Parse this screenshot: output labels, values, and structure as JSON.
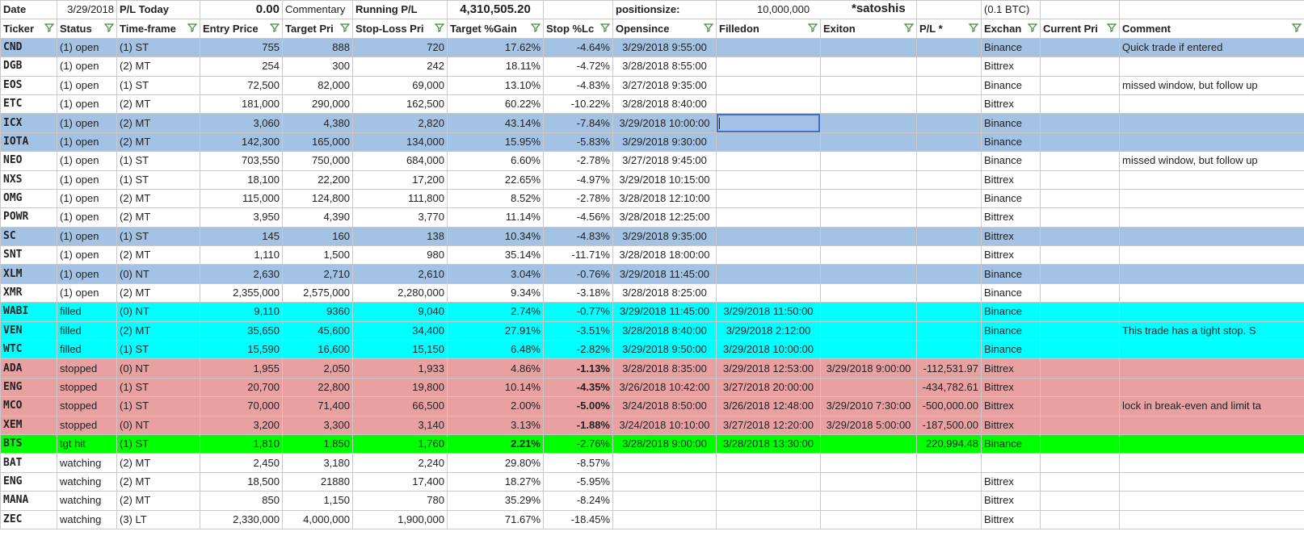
{
  "colors": {
    "open_blue": "#a4c2e4",
    "filled_cyan": "#00ffff",
    "stopped_red": "#e8a0a0",
    "tgt_green": "#00ff00",
    "filter_icon": "#3a8a3a",
    "white": "#ffffff"
  },
  "meta": {
    "date_label": "Date",
    "date_value": "3/29/2018",
    "pl_today_label": "P/L Today",
    "pl_today_value": "0.00",
    "commentary_label": "Commentary",
    "running_pl_label": "Running P/L",
    "running_pl_value": "4,310,505.20",
    "positionsize_label": "positionsize:",
    "positionsize_value": "10,000,000",
    "satoshis_label": "*satoshis",
    "btc_note": "(0.1 BTC)"
  },
  "headers": [
    "Ticker",
    "Status",
    "Time-frame",
    "Entry Price",
    "Target Pri",
    "Stop-Loss Pri",
    "Target %Gain",
    "Stop %Lc",
    "Opensince",
    "Filledon",
    "Exiton",
    "P/L *",
    "Exchan",
    "Current Pri",
    "Comment"
  ],
  "rows": [
    {
      "c": [
        "CND",
        "(1) open",
        "(1) ST",
        "755",
        "888",
        "720",
        "17.62%",
        "-4.64%",
        "3/29/2018 9:55:00",
        "",
        "",
        "",
        "Binance",
        "",
        "Quick trade if entered"
      ],
      "color": "open_blue"
    },
    {
      "c": [
        "DGB",
        "(1) open",
        "(2) MT",
        "254",
        "300",
        "242",
        "18.11%",
        "-4.72%",
        "3/28/2018 8:55:00",
        "",
        "",
        "",
        "Bittrex",
        "",
        ""
      ],
      "color": "white"
    },
    {
      "c": [
        "EOS",
        "(1) open",
        "(1) ST",
        "72,500",
        "82,000",
        "69,000",
        "13.10%",
        "-4.83%",
        "3/27/2018 9:35:00",
        "",
        "",
        "",
        "Binance",
        "",
        "missed window, but follow up"
      ],
      "color": "white"
    },
    {
      "c": [
        "ETC",
        "(1) open",
        "(2) MT",
        "181,000",
        "290,000",
        "162,500",
        "60.22%",
        "-10.22%",
        "3/28/2018 8:40:00",
        "",
        "",
        "",
        "Bittrex",
        "",
        ""
      ],
      "color": "white"
    },
    {
      "c": [
        "ICX",
        "(1) open",
        "(2) MT",
        "3,060",
        "4,380",
        "2,820",
        "43.14%",
        "-7.84%",
        "3/29/2018 10:00:00",
        "",
        "",
        "",
        "Binance",
        "",
        ""
      ],
      "color": "open_blue"
    },
    {
      "c": [
        "IOTA",
        "(1) open",
        "(2) MT",
        "142,300",
        "165,000",
        "134,000",
        "15.95%",
        "-5.83%",
        "3/29/2018 9:30:00",
        "",
        "",
        "",
        "Binance",
        "",
        ""
      ],
      "color": "open_blue"
    },
    {
      "c": [
        "NEO",
        "(1) open",
        "(1) ST",
        "703,550",
        "750,000",
        "684,000",
        "6.60%",
        "-2.78%",
        "3/27/2018 9:45:00",
        "",
        "",
        "",
        "Binance",
        "",
        "missed window, but follow up"
      ],
      "color": "white"
    },
    {
      "c": [
        "NXS",
        "(1) open",
        "(1) ST",
        "18,100",
        "22,200",
        "17,200",
        "22.65%",
        "-4.97%",
        "3/29/2018 10:15:00",
        "",
        "",
        "",
        "Bittrex",
        "",
        ""
      ],
      "color": "white"
    },
    {
      "c": [
        "OMG",
        "(1) open",
        "(2) MT",
        "115,000",
        "124,800",
        "111,800",
        "8.52%",
        "-2.78%",
        "3/28/2018 12:10:00",
        "",
        "",
        "",
        "Binance",
        "",
        ""
      ],
      "color": "white"
    },
    {
      "c": [
        "POWR",
        "(1) open",
        "(2) MT",
        "3,950",
        "4,390",
        "3,770",
        "11.14%",
        "-4.56%",
        "3/28/2018 12:25:00",
        "",
        "",
        "",
        "Bittrex",
        "",
        ""
      ],
      "color": "white"
    },
    {
      "c": [
        "SC",
        "(1) open",
        "(1) ST",
        "145",
        "160",
        "138",
        "10.34%",
        "-4.83%",
        "3/29/2018 9:35:00",
        "",
        "",
        "",
        "Bittrex",
        "",
        ""
      ],
      "color": "open_blue"
    },
    {
      "c": [
        "SNT",
        "(1) open",
        "(2) MT",
        "1,110",
        "1,500",
        "980",
        "35.14%",
        "-11.71%",
        "3/28/2018 18:00:00",
        "",
        "",
        "",
        "Bittrex",
        "",
        ""
      ],
      "color": "white"
    },
    {
      "c": [
        "XLM",
        "(1) open",
        "(0) NT",
        "2,630",
        "2,710",
        "2,610",
        "3.04%",
        "-0.76%",
        "3/29/2018 11:45:00",
        "",
        "",
        "",
        "Binance",
        "",
        ""
      ],
      "color": "open_blue"
    },
    {
      "c": [
        "XMR",
        "(1) open",
        "(2) MT",
        "2,355,000",
        "2,575,000",
        "2,280,000",
        "9.34%",
        "-3.18%",
        "3/28/2018 8:25:00",
        "",
        "",
        "",
        "Binance",
        "",
        ""
      ],
      "color": "white"
    },
    {
      "c": [
        "WABI",
        "filled",
        "(0) NT",
        "9,110",
        "9360",
        "9,040",
        "2.74%",
        "-0.77%",
        "3/29/2018 11:45:00",
        "3/29/2018 11:50:00",
        "",
        "",
        "Binance",
        "",
        ""
      ],
      "color": "filled_cyan"
    },
    {
      "c": [
        "VEN",
        "filled",
        "(2) MT",
        "35,650",
        "45,600",
        "34,400",
        "27.91%",
        "-3.51%",
        "3/28/2018 8:40:00",
        "3/29/2018 2:12:00",
        "",
        "",
        "Binance",
        "",
        "This trade has a tight stop. S"
      ],
      "color": "filled_cyan"
    },
    {
      "c": [
        "WTC",
        "filled",
        "(1) ST",
        "15,590",
        "16,600",
        "15,150",
        "6.48%",
        "-2.82%",
        "3/29/2018 9:50:00",
        "3/29/2018 10:00:00",
        "",
        "",
        "Binance",
        "",
        ""
      ],
      "color": "filled_cyan"
    },
    {
      "c": [
        "ADA",
        "stopped",
        "(0) NT",
        "1,955",
        "2,050",
        "1,933",
        "4.86%",
        "-1.13%",
        "3/28/2018 8:35:00",
        "3/29/2018 12:53:00",
        "3/29/2018 9:00:00",
        "-112,531.97",
        "Bittrex",
        "",
        ""
      ],
      "color": "stopped_red",
      "boldStop": true
    },
    {
      "c": [
        "ENG",
        "stopped",
        "(1) ST",
        "20,700",
        "22,800",
        "19,800",
        "10.14%",
        "-4.35%",
        "3/26/2018 10:42:00",
        "3/27/2018 20:00:00",
        "",
        "-434,782.61",
        "Bittrex",
        "",
        ""
      ],
      "color": "stopped_red",
      "boldStop": true
    },
    {
      "c": [
        "MCO",
        "stopped",
        "(1) ST",
        "70,000",
        "71,400",
        "66,500",
        "2.00%",
        "-5.00%",
        "3/24/2018 8:50:00",
        "3/26/2018 12:48:00",
        "3/29/2010 7:30:00",
        "-500,000.00",
        "Bittrex",
        "",
        "lock in break-even and limit ta"
      ],
      "color": "stopped_red",
      "boldStop": true
    },
    {
      "c": [
        "XEM",
        "stopped",
        "(0) NT",
        "3,200",
        "3,300",
        "3,140",
        "3.13%",
        "-1.88%",
        "3/24/2018 10:10:00",
        "3/27/2018 12:20:00",
        "3/29/2018 5:00:00",
        "-187,500.00",
        "Bittrex",
        "",
        ""
      ],
      "color": "stopped_red",
      "boldStop": true
    },
    {
      "c": [
        "BTS",
        "tgt hit",
        "(1) ST",
        "1,810",
        "1,850",
        "1,760",
        "2.21%",
        "-2.76%",
        "3/28/2018 9:00:00",
        "3/28/2018 13:30:00",
        "",
        "220,994.48",
        "Binance",
        "",
        ""
      ],
      "color": "tgt_green",
      "boldGain": true
    },
    {
      "c": [
        "BAT",
        "watching",
        "(2) MT",
        "2,450",
        "3,180",
        "2,240",
        "29.80%",
        "-8.57%",
        "",
        "",
        "",
        "",
        "",
        "",
        ""
      ],
      "color": "white"
    },
    {
      "c": [
        "ENG",
        "watching",
        "(2) MT",
        "18,500",
        "21880",
        "17,400",
        "18.27%",
        "-5.95%",
        "",
        "",
        "",
        "",
        "Bittrex",
        "",
        ""
      ],
      "color": "white"
    },
    {
      "c": [
        "MANA",
        "watching",
        "(2) MT",
        "850",
        "1,150",
        "780",
        "35.29%",
        "-8.24%",
        "",
        "",
        "",
        "",
        "Bittrex",
        "",
        ""
      ],
      "color": "white"
    },
    {
      "c": [
        "ZEC",
        "watching",
        "(3) LT",
        "2,330,000",
        "4,000,000",
        "1,900,000",
        "71.67%",
        "-18.45%",
        "",
        "",
        "",
        "",
        "Bittrex",
        "",
        ""
      ],
      "color": "white"
    }
  ]
}
